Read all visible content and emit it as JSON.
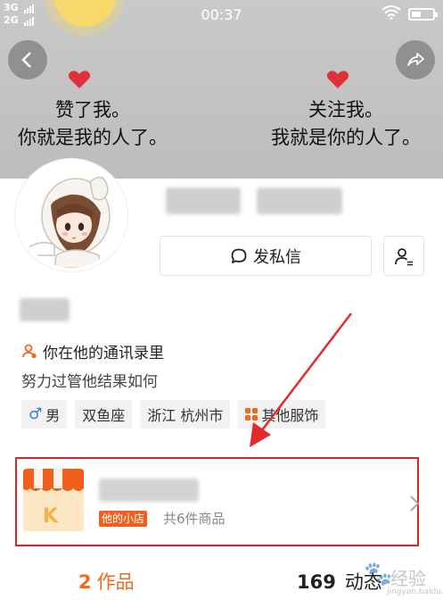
{
  "status_bar": {
    "network_1": "3G",
    "network_2": "2G",
    "time": "00:37"
  },
  "cover": {
    "left_lines": [
      "赞了我。",
      "你就是我的人了。"
    ],
    "right_lines": [
      "关注我。",
      "我就是你的人了。"
    ],
    "heart_color": "#e0303a"
  },
  "actions": {
    "message_label": "发私信"
  },
  "profile": {
    "contact_note": "你在他的通讯录里",
    "bio": "努力过管他结果如何",
    "tags": [
      {
        "icon": "♂",
        "label": "男"
      },
      {
        "icon": "",
        "label": "双鱼座"
      },
      {
        "icon": "",
        "label": "浙江 杭州市"
      },
      {
        "icon": "grid",
        "label": "其他服饰"
      }
    ]
  },
  "shop": {
    "badge": "他的小店",
    "count_text": "共6件商品",
    "logo_letter": "K"
  },
  "tabs": {
    "works_count": "2",
    "works_label": "作品",
    "feed_count": "169",
    "feed_label": "动态"
  },
  "watermark": {
    "text": "经验",
    "url": "jingyan.baidu.com"
  },
  "colors": {
    "accent": "#f26a1b",
    "highlight_box": "#d9262c",
    "shop_badge": "#f0601c"
  }
}
